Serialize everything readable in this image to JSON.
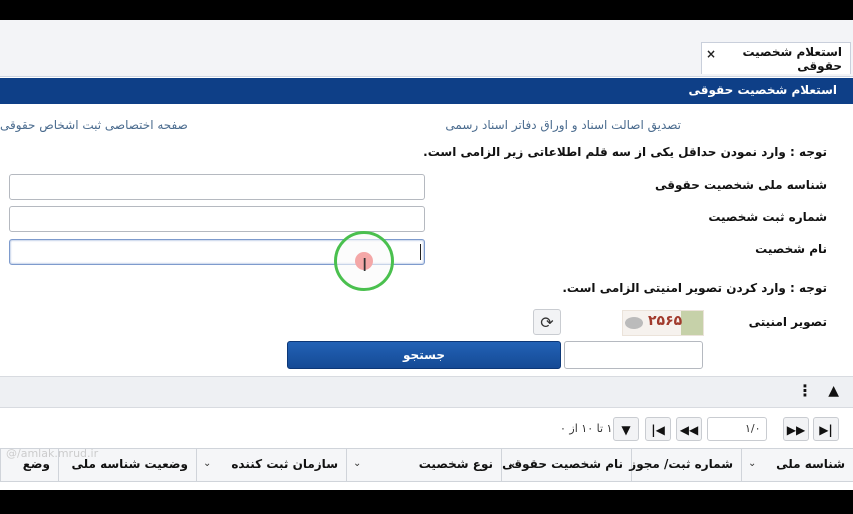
{
  "tab": {
    "label": "استعلام شخصیت حقوقی",
    "close": "×"
  },
  "header": {
    "title": "استعلام شخصیت حقوقی"
  },
  "links": {
    "verify_docs": "تصدیق اصالت اسناد و اوراق دفاتر اسناد رسمی",
    "registration_page": "صفحه اختصاصی ثبت اشخاص حقوقی"
  },
  "form": {
    "note_required_one": "توجه : وارد نمودن حداقل یکی از سه قلم اطلاعاتی زیر الزامی است.",
    "national_id_label": "شناسه ملی شخصیت حقوقی",
    "registration_number_label": "شماره ثبت شخصیت",
    "name_label": "نام شخصیت",
    "note_captcha": "توجه : وارد کردن تصویر امنیتی الزامی است.",
    "captcha_label": "تصویر امنیتی",
    "captcha_text": "۲۵۶۵",
    "search_button": "جستجو"
  },
  "pager": {
    "page_of": "۱/۰",
    "info": "۱ تا ۱۰ از ۰"
  },
  "columns": [
    {
      "label": "شناسه ملی"
    },
    {
      "label": "شماره ثبت/ مجوز"
    },
    {
      "label": "نام شخصیت حقوقی"
    },
    {
      "label": "نوع شخصیت"
    },
    {
      "label": "سازمان ثبت کننده"
    },
    {
      "label": "وضعیت شناسه ملی"
    },
    {
      "label": "وضع"
    }
  ],
  "watermark": "@/amlak.mrud.ir",
  "icons": {
    "tab_close": "close-icon",
    "refresh": "refresh-icon",
    "collapse": "chevron-up-icon",
    "more": "more-vertical-icon",
    "pager_last": "last-page-icon",
    "pager_next": "next-page-icon",
    "pager_prev": "prev-page-icon",
    "pager_first": "first-page-icon",
    "filter": "filter-icon"
  },
  "colors": {
    "header_bg": "#0e3f87",
    "button_bg": "#1a55a6",
    "focus_ring": "#4ac04e"
  }
}
